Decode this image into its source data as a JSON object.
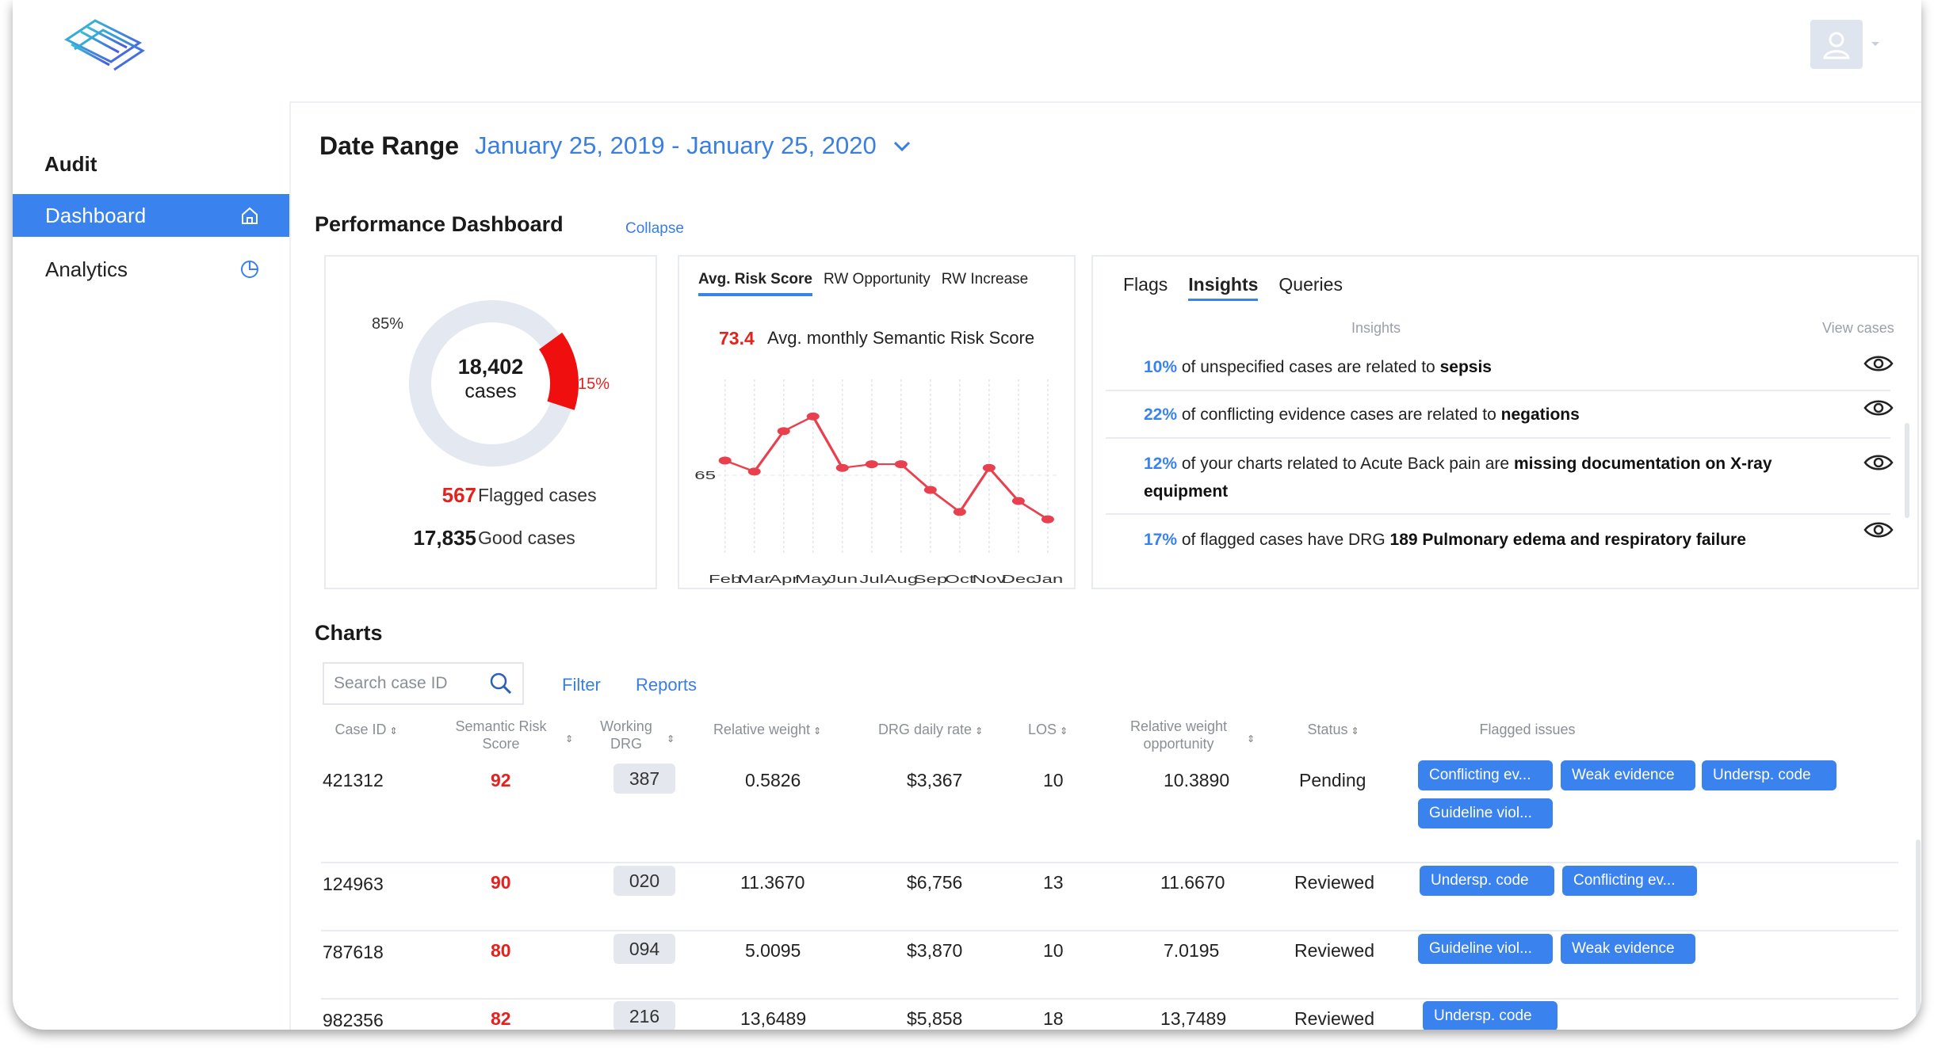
{
  "brand": {
    "logo_icon": "stacked-layers-logo",
    "accent": "#3a82ee",
    "alert": "#e5211d"
  },
  "sidebar": {
    "section_title": "Audit",
    "items": [
      {
        "label": "Dashboard",
        "icon": "home-icon",
        "active": true
      },
      {
        "label": "Analytics",
        "icon": "pie-chart-icon",
        "active": false
      }
    ]
  },
  "header": {
    "avatar_icon": "user-icon"
  },
  "date_range": {
    "label": "Date Range",
    "value": "January 25, 2019 - January 25, 2020"
  },
  "performance": {
    "title": "Performance Dashboard",
    "collapse_label": "Collapse",
    "donut": {
      "total": "18,402",
      "total_label": "cases",
      "good_pct_label": "85%",
      "flagged_pct_label": "15%",
      "flagged_fraction": 0.15,
      "flagged_count": "567",
      "flagged_label": "Flagged cases",
      "good_count": "17,835",
      "good_label": "Good cases"
    },
    "risk_chart": {
      "tabs": [
        "Avg. Risk Score",
        "RW Opportunity",
        "RW Increase"
      ],
      "value": "73.4",
      "title": "Avg. monthly Semantic Risk Score"
    },
    "insights": {
      "tabs": [
        "Flags",
        "Insights",
        "Queries"
      ],
      "col_insights": "Insights",
      "col_view": "View cases",
      "rows": [
        {
          "pct": "10%",
          "text": "of unspecified cases are related to",
          "bold": "sepsis",
          "tail": ""
        },
        {
          "pct": "22%",
          "text": "of conflicting evidence cases are related to",
          "bold": "negations",
          "tail": ""
        },
        {
          "pct": "12%",
          "text": "of your charts related to Acute Back pain are",
          "bold": "missing documentation on X-ray equipment",
          "tail": ""
        },
        {
          "pct": "17%",
          "text": "of flagged cases have DRG",
          "bold": "189 Pulmonary edema and respiratory failure",
          "tail": ""
        }
      ]
    }
  },
  "chart_data": {
    "type": "line",
    "title": "Avg. monthly Semantic Risk Score",
    "categories": [
      "Feb",
      "Mar",
      "Apr",
      "May",
      "Jun",
      "Jul",
      "Aug",
      "Sep",
      "Oct",
      "Nov",
      "Dec",
      "Jan"
    ],
    "series": [
      {
        "values": [
          65.4,
          65.1,
          66.2,
          66.6,
          65.2,
          65.3,
          65.3,
          64.6,
          64.0,
          65.2,
          64.3,
          63.8
        ]
      }
    ],
    "y_ticks": [
      "65"
    ],
    "ylim": [
      62.5,
      67.5
    ],
    "grid": true,
    "color": "#e8404f"
  },
  "charts_section": {
    "title": "Charts",
    "search_placeholder": "Search case ID",
    "filter_label": "Filter",
    "reports_label": "Reports",
    "columns": {
      "case_id": "Case ID",
      "risk_1": "Semantic Risk",
      "risk_2": "Score",
      "drg_1": "Working",
      "drg_2": "DRG",
      "rw": "Relative weight",
      "rate": "DRG daily rate",
      "los": "LOS",
      "rwo_1": "Relative weight",
      "rwo_2": "opportunity",
      "status": "Status",
      "issues": "Flagged issues"
    },
    "rows": [
      {
        "case_id": "421312",
        "risk": "92",
        "drg": "387",
        "rw": "0.5826",
        "rate": "$3,367",
        "los": "10",
        "rwo": "10.3890",
        "status": "Pending",
        "issues": [
          "Conflicting ev...",
          "Weak evidence",
          "Undersp. code",
          "Guideline viol..."
        ]
      },
      {
        "case_id": "124963",
        "risk": "90",
        "drg": "020",
        "rw": "11.3670",
        "rate": "$6,756",
        "los": "13",
        "rwo": "11.6670",
        "status": "Reviewed",
        "issues": [
          "Undersp. code",
          "Conflicting ev..."
        ]
      },
      {
        "case_id": "787618",
        "risk": "80",
        "drg": "094",
        "rw": "5.0095",
        "rate": "$3,870",
        "los": "10",
        "rwo": "7.0195",
        "status": "Reviewed",
        "issues": [
          "Guideline viol...",
          "Weak evidence"
        ]
      },
      {
        "case_id": "982356",
        "risk": "82",
        "drg": "216",
        "rw": "13,6489",
        "rate": "$5,858",
        "los": "18",
        "rwo": "13,7489",
        "status": "Reviewed",
        "issues": [
          "Undersp. code"
        ]
      }
    ]
  }
}
